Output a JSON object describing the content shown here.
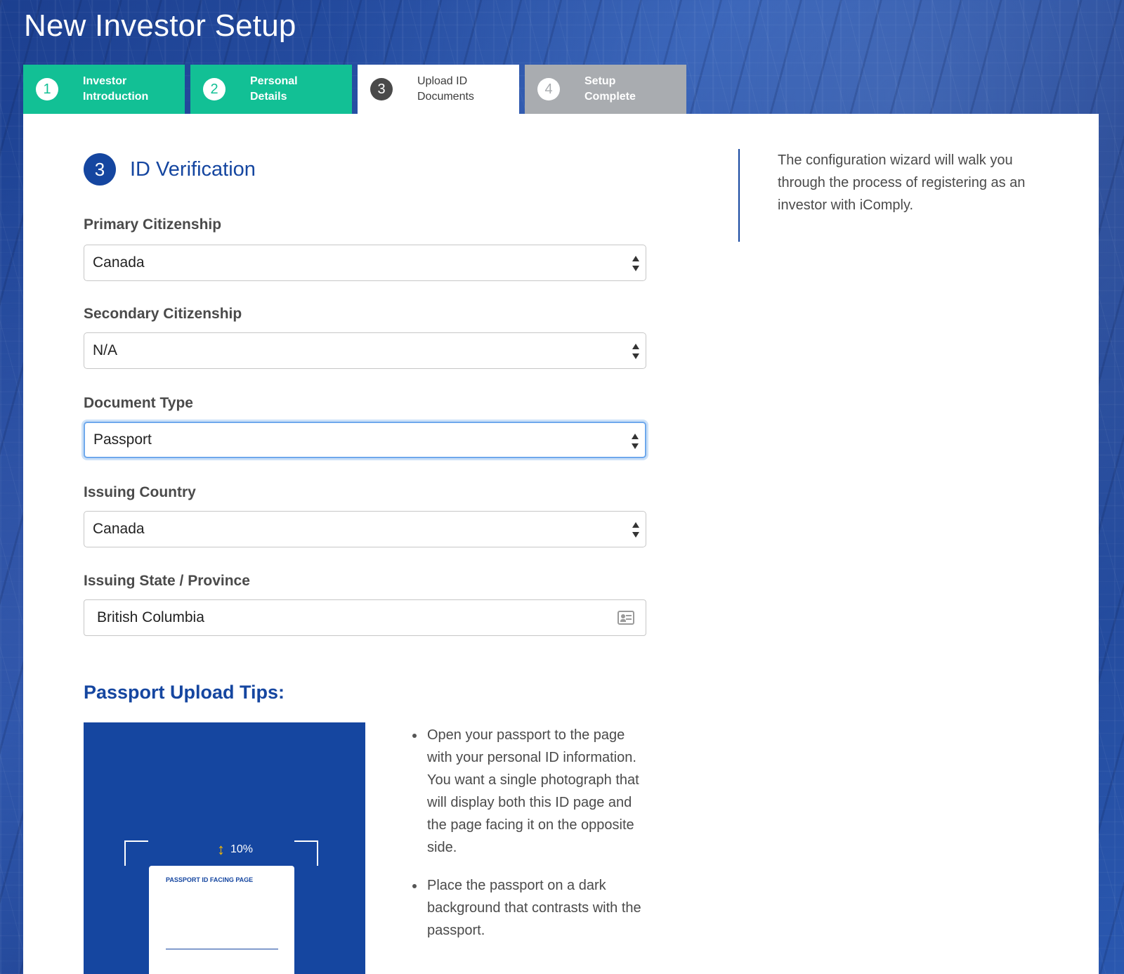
{
  "page": {
    "title": "New Investor Setup"
  },
  "steps": [
    {
      "number": "1",
      "label_line1": "Investor",
      "label_line2": "Introduction",
      "state": "done"
    },
    {
      "number": "2",
      "label_line1": "Personal",
      "label_line2": "Details",
      "state": "done"
    },
    {
      "number": "3",
      "label_line1": "Upload ID",
      "label_line2": "Documents",
      "state": "active"
    },
    {
      "number": "4",
      "label_line1": "Setup",
      "label_line2": "Complete",
      "state": "pending"
    }
  ],
  "section": {
    "number": "3",
    "title": "ID Verification"
  },
  "form": {
    "primary_citizenship": {
      "label": "Primary Citizenship",
      "value": "Canada"
    },
    "secondary_citizenship": {
      "label": "Secondary Citizenship",
      "value": "N/A"
    },
    "document_type": {
      "label": "Document Type",
      "value": "Passport"
    },
    "issuing_country": {
      "label": "Issuing Country",
      "value": "Canada"
    },
    "issuing_state": {
      "label": "Issuing State / Province",
      "value": "British Columbia"
    }
  },
  "sidebar": {
    "intro_text": "The configuration wizard will walk you through the process of registering as an investor with iComply."
  },
  "tips": {
    "title": "Passport Upload Tips:",
    "image": {
      "margin_label": "10%",
      "page_label": "PASSPORT ID FACING PAGE"
    },
    "items": [
      "Open your passport to the page with your personal ID information. You want a single photograph that will display both this ID page and the page facing it on the opposite side.",
      "Place the passport on a dark background that contrasts with the passport."
    ]
  },
  "colors": {
    "brand_blue": "#1546a0",
    "step_done": "#12c095",
    "step_pending": "#a9acb0",
    "focus_ring": "#6ea8ec",
    "accent_yellow": "#f5b800"
  },
  "icons": {
    "select_arrows": "updown-caret-icon",
    "issuing_state": "contact-card-icon",
    "margin_indicator": "vertical-arrows-icon"
  }
}
